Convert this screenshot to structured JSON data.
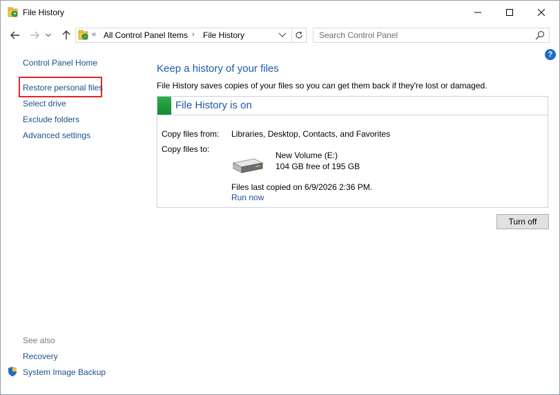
{
  "window": {
    "title": "File History"
  },
  "address": {
    "overflow": "«",
    "crumbs": [
      "All Control Panel Items",
      "File History"
    ],
    "separator": "›"
  },
  "search": {
    "placeholder": "Search Control Panel"
  },
  "help": {
    "label": "?"
  },
  "left_pane": {
    "home": "Control Panel Home",
    "items": [
      "Restore personal files",
      "Select drive",
      "Exclude folders",
      "Advanced settings"
    ],
    "see_also": "See also",
    "see_also_items": [
      "Recovery",
      "System Image Backup"
    ]
  },
  "main": {
    "title": "Keep a history of your files",
    "description": "File History saves copies of your files so you can get them back if they're lost or damaged.",
    "status": "File History is on",
    "copy_from_label": "Copy files from:",
    "copy_from_value": "Libraries, Desktop, Contacts, and Favorites",
    "copy_to_label": "Copy files to:",
    "drive_name": "New Volume (E:)",
    "drive_free": "104 GB free of 195 GB",
    "last_copied": "Files last copied on 6/9/2026 2:36 PM.",
    "run_now": "Run now",
    "turn_off": "Turn off"
  },
  "colors": {
    "link": "#1b4f8c",
    "heading": "#1e5aa8",
    "highlight": "#e3222a",
    "status_green": "#2fae4a"
  },
  "icons": [
    "file-history-icon",
    "minimize-icon",
    "maximize-icon",
    "close-icon",
    "back-arrow-icon",
    "forward-arrow-icon",
    "dropdown-icon",
    "up-arrow-icon",
    "refresh-icon",
    "search-icon",
    "help-icon",
    "drive-icon",
    "shield-icon"
  ]
}
